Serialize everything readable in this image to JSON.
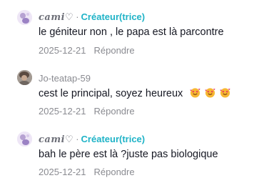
{
  "comments": [
    {
      "username": "cami♡",
      "creator_label": "Créateur(trice)",
      "text": "le géniteur non , le papa est là parcontre",
      "date": "2025-12-21",
      "reply": "Répondre"
    },
    {
      "username": "Jo-teatap-59",
      "text": "cest le principal, soyez heureux",
      "emojis": [
        "smiling-face-with-hearts",
        "smiling-face-with-hearts",
        "smiling-face-with-hearts"
      ],
      "date": "2025-12-21",
      "reply": "Répondre"
    },
    {
      "username": "cami♡",
      "creator_label": "Créateur(trice)",
      "text": "bah le père est là ?juste pas biologique",
      "date": "2025-12-21",
      "reply": "Répondre"
    }
  ],
  "separator": "·"
}
